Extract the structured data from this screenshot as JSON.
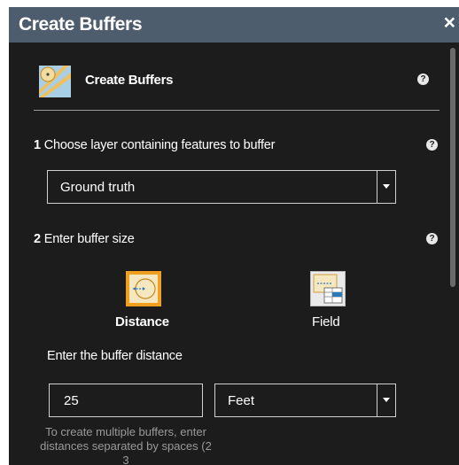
{
  "window": {
    "title": "Create Buffers",
    "close_label": "×"
  },
  "widget": {
    "title": "Create Buffers"
  },
  "step1": {
    "number": "1",
    "text": "Choose layer containing features to buffer",
    "selected_layer": "Ground truth"
  },
  "step2": {
    "number": "2",
    "text": "Enter buffer size",
    "options": [
      {
        "label": "Distance",
        "selected": true
      },
      {
        "label": "Field",
        "selected": false
      }
    ]
  },
  "distance": {
    "label": "Enter the buffer distance",
    "value": "25",
    "unit": "Feet",
    "hint": "To create multiple buffers, enter distances separated by spaces (2 3"
  },
  "help_glyph": "?",
  "colors": {
    "title_bar": "#4d5d6e",
    "panel": "#1c1c1c",
    "selected_accent": "#f0a020"
  }
}
